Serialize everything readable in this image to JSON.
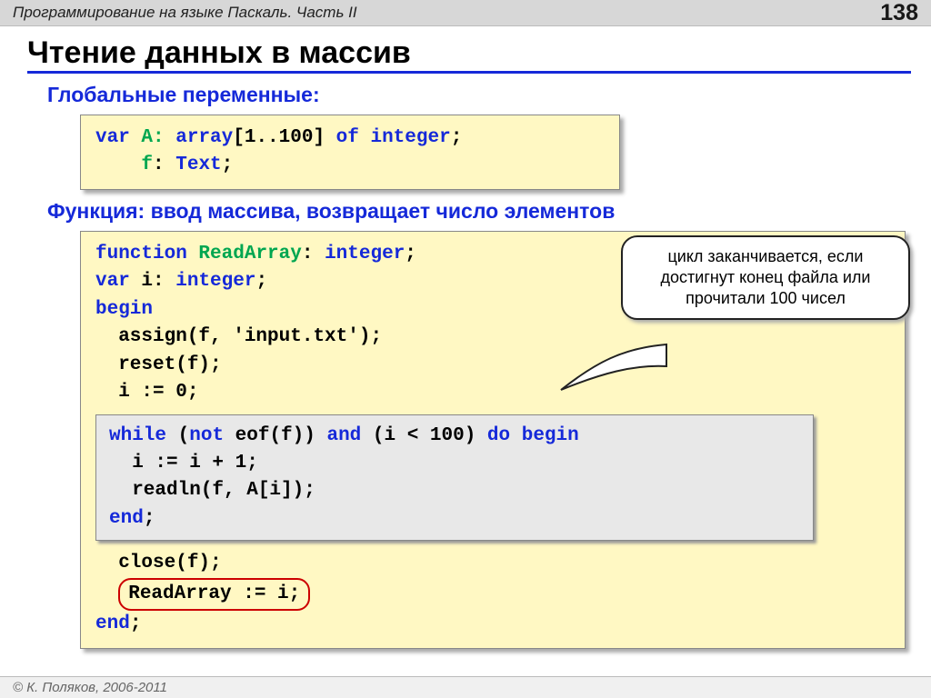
{
  "header": {
    "breadcrumb": "Программирование на языке Паскаль. Часть II",
    "page_number": "138"
  },
  "title": "Чтение данных в массив",
  "section1": "Глобальные переменные:",
  "code1": {
    "l1a": "var",
    "l1b": " A: ",
    "l1c": "array",
    "l1d": "[1..100] ",
    "l1e": "of integer",
    "l1f": ";",
    "l2a": "    ",
    "l2b": "f",
    "l2c": ": ",
    "l2d": "Text",
    "l2e": ";"
  },
  "section2": "Функция: ввод массива, возвращает число элементов",
  "code2": {
    "l1a": "function",
    "l1b": " ReadArray",
    "l1c": ": ",
    "l1d": "integer",
    "l1e": ";",
    "l2a": "var",
    "l2b": " i: ",
    "l2c": "integer",
    "l2d": ";",
    "l3a": "begin",
    "l4": "  assign(f, 'input.txt');",
    "l5": "  reset(f);",
    "l6": "  i := 0;",
    "inner": {
      "l1a": "while",
      "l1b": " (",
      "l1c": "not",
      "l1d": " eof(f)) ",
      "l1e": "and",
      "l1f": " (i < 100) ",
      "l1g": "do begin",
      "l2": "  i := i + 1;",
      "l3": "  readln(f, A[i]);",
      "l4a": "end",
      "l4b": ";"
    },
    "l7": "  close(f);",
    "l8a": "  ",
    "l8b": "ReadArray := i;",
    "l9a": "end",
    "l9b": ";"
  },
  "callout": "цикл заканчивается, если достигнут конец файла или прочитали 100 чисел",
  "footer": "© К. Поляков, 2006-2011"
}
